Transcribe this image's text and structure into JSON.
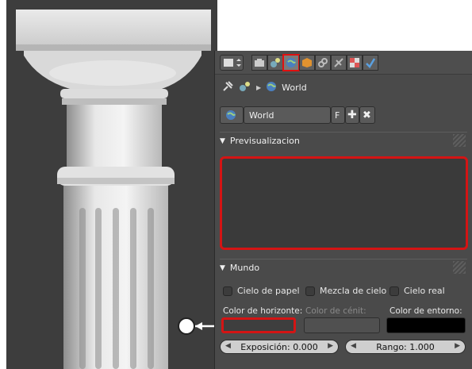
{
  "breadcrumb": {
    "label": "World"
  },
  "datablock": {
    "name": "World",
    "fake_user": "F"
  },
  "preview_panel": {
    "title": "Previsualizacion"
  },
  "world_panel": {
    "title": "Mundo",
    "checkboxes": [
      {
        "label": "Cielo de papel",
        "checked": false
      },
      {
        "label": "Mezcla de cielo",
        "checked": false
      },
      {
        "label": "Cielo real",
        "checked": false
      }
    ],
    "horizon_label": "Color de horizonte:",
    "zenith_label": "Color de cénit:",
    "ambient_label": "Color de entorno:",
    "horizon_color": "#3e3e3e",
    "zenith_color": "#505050",
    "ambient_color": "#000000",
    "exposure": "Exposición: 0.000",
    "range": "Rango: 1.000"
  },
  "colors": {
    "highlight": "#d41414",
    "panel_bg": "#4a4a4a"
  }
}
